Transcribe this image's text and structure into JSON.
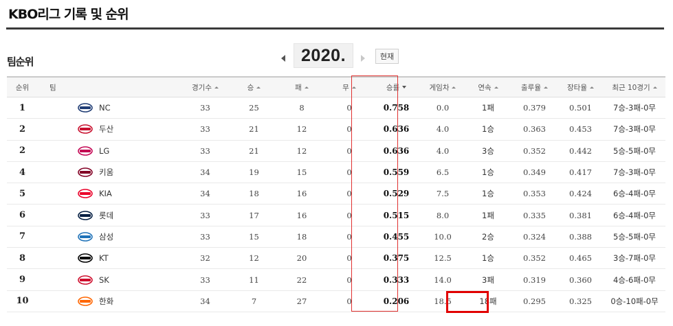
{
  "page": {
    "title": "KBO리그 기록 및 순위"
  },
  "standings": {
    "section_title": "팀순위",
    "season": "2020.",
    "current_button": "현재",
    "columns": [
      "순위",
      "팀",
      "경기수",
      "승",
      "패",
      "무",
      "승률",
      "게임차",
      "연속",
      "출루율",
      "장타율",
      "최근 10경기"
    ],
    "rows": [
      {
        "rank": "1",
        "team": "NC",
        "games": "33",
        "wins": "25",
        "losses": "8",
        "draws": "0",
        "pct": "0.758",
        "gb": "0.0",
        "streak": "1패",
        "obp": "0.379",
        "slg": "0.501",
        "last10": "7승-3패-0무",
        "logo_color": "#1f3c74",
        "logo_icon": "nc-dinos-logo-icon"
      },
      {
        "rank": "2",
        "team": "두산",
        "games": "33",
        "wins": "21",
        "losses": "12",
        "draws": "0",
        "pct": "0.636",
        "gb": "4.0",
        "streak": "1승",
        "obp": "0.363",
        "slg": "0.453",
        "last10": "7승-3패-0무",
        "logo_color": "#c8102e",
        "logo_icon": "doosan-bears-logo-icon"
      },
      {
        "rank": "2",
        "team": "LG",
        "games": "33",
        "wins": "21",
        "losses": "12",
        "draws": "0",
        "pct": "0.636",
        "gb": "4.0",
        "streak": "3승",
        "obp": "0.352",
        "slg": "0.442",
        "last10": "5승-5패-0무",
        "logo_color": "#c30452",
        "logo_icon": "lg-twins-logo-icon"
      },
      {
        "rank": "4",
        "team": "키움",
        "games": "34",
        "wins": "19",
        "losses": "15",
        "draws": "0",
        "pct": "0.559",
        "gb": "6.5",
        "streak": "1승",
        "obp": "0.349",
        "slg": "0.417",
        "last10": "7승-3패-0무",
        "logo_color": "#820024",
        "logo_icon": "kiwoom-heroes-logo-icon"
      },
      {
        "rank": "5",
        "team": "KIA",
        "games": "34",
        "wins": "18",
        "losses": "16",
        "draws": "0",
        "pct": "0.529",
        "gb": "7.5",
        "streak": "1승",
        "obp": "0.353",
        "slg": "0.424",
        "last10": "6승-4패-0무",
        "logo_color": "#ea0029",
        "logo_icon": "kia-tigers-logo-icon"
      },
      {
        "rank": "6",
        "team": "롯데",
        "games": "33",
        "wins": "17",
        "losses": "16",
        "draws": "0",
        "pct": "0.515",
        "gb": "8.0",
        "streak": "1패",
        "obp": "0.335",
        "slg": "0.381",
        "last10": "6승-4패-0무",
        "logo_color": "#041e42",
        "logo_icon": "lotte-giants-logo-icon"
      },
      {
        "rank": "7",
        "team": "삼성",
        "games": "33",
        "wins": "15",
        "losses": "18",
        "draws": "0",
        "pct": "0.455",
        "gb": "10.0",
        "streak": "2승",
        "obp": "0.324",
        "slg": "0.388",
        "last10": "5승-5패-0무",
        "logo_color": "#1f72b8",
        "logo_icon": "samsung-lions-logo-icon"
      },
      {
        "rank": "8",
        "team": "KT",
        "games": "32",
        "wins": "12",
        "losses": "20",
        "draws": "0",
        "pct": "0.375",
        "gb": "12.5",
        "streak": "1승",
        "obp": "0.352",
        "slg": "0.465",
        "last10": "3승-7패-0무",
        "logo_color": "#000000",
        "logo_icon": "kt-wiz-logo-icon"
      },
      {
        "rank": "9",
        "team": "SK",
        "games": "33",
        "wins": "11",
        "losses": "22",
        "draws": "0",
        "pct": "0.333",
        "gb": "14.0",
        "streak": "3패",
        "obp": "0.319",
        "slg": "0.360",
        "last10": "4승-6패-0무",
        "logo_color": "#ce0e2d",
        "logo_icon": "sk-wyverns-logo-icon"
      },
      {
        "rank": "10",
        "team": "한화",
        "games": "34",
        "wins": "7",
        "losses": "27",
        "draws": "0",
        "pct": "0.206",
        "gb": "18.5",
        "streak": "18패",
        "obp": "0.295",
        "slg": "0.325",
        "last10": "0승-10패-0무",
        "logo_color": "#ff6600",
        "logo_icon": "hanwha-eagles-logo-icon"
      }
    ]
  },
  "highlight_colors": {
    "pct_column_frame": "#e0302f",
    "streak_cell_frame": "#e10000"
  }
}
